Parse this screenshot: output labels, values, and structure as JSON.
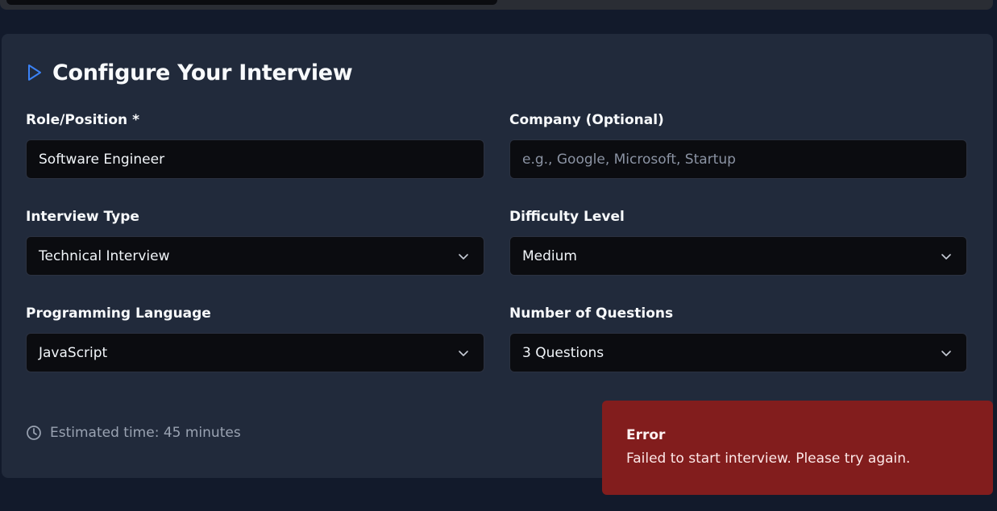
{
  "header": {
    "title": "Configure Your Interview",
    "icon": "play-icon",
    "accent_color": "#3b82f6"
  },
  "form": {
    "role": {
      "label": "Role/Position *",
      "value": "Software Engineer"
    },
    "company": {
      "label": "Company (Optional)",
      "value": "",
      "placeholder": "e.g., Google, Microsoft, Startup"
    },
    "interview_type": {
      "label": "Interview Type",
      "selected": "Technical Interview"
    },
    "difficulty": {
      "label": "Difficulty Level",
      "selected": "Medium"
    },
    "language": {
      "label": "Programming Language",
      "selected": "JavaScript"
    },
    "questions": {
      "label": "Number of Questions",
      "selected": "3 Questions"
    }
  },
  "footer": {
    "estimated_time": "Estimated time: 45 minutes",
    "icon": "clock-icon"
  },
  "toast": {
    "title": "Error",
    "message": "Failed to start interview. Please try again.",
    "color": "#821d1d"
  }
}
